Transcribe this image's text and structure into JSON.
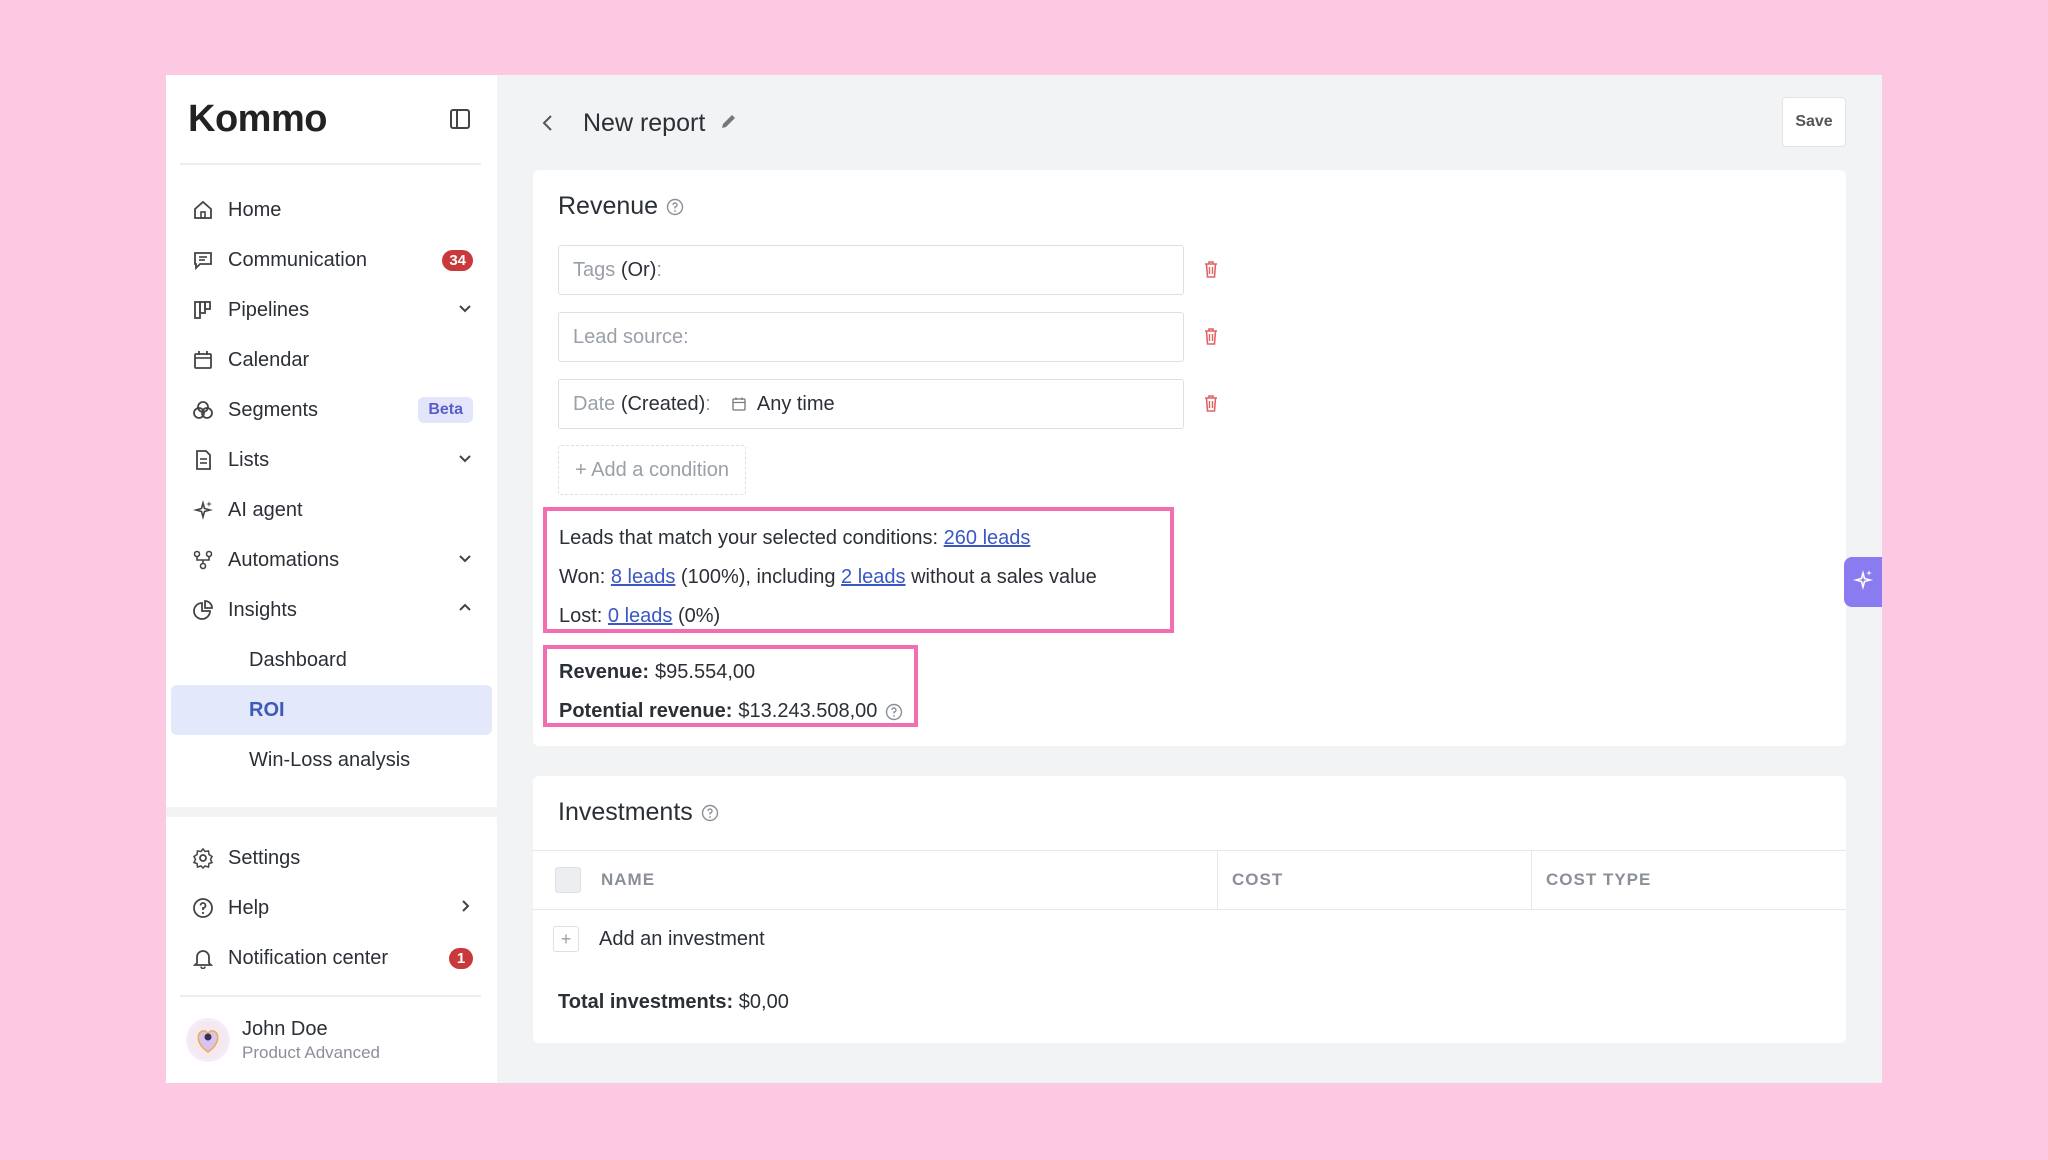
{
  "brand": {
    "logo_text": "Kommo"
  },
  "sidebar": {
    "items": [
      {
        "label": "Home",
        "icon": "home-icon"
      },
      {
        "label": "Communication",
        "icon": "chat-icon",
        "badge": "34"
      },
      {
        "label": "Pipelines",
        "icon": "pipelines-icon",
        "chevron": "down"
      },
      {
        "label": "Calendar",
        "icon": "calendar-icon"
      },
      {
        "label": "Segments",
        "icon": "segments-icon",
        "badge": "Beta"
      },
      {
        "label": "Lists",
        "icon": "lists-icon",
        "chevron": "down"
      },
      {
        "label": "AI agent",
        "icon": "sparkles-icon"
      },
      {
        "label": "Automations",
        "icon": "automations-icon",
        "chevron": "down"
      },
      {
        "label": "Insights",
        "icon": "insights-icon",
        "chevron": "up"
      }
    ],
    "insights_sub": [
      "Dashboard",
      "ROI",
      "Win-Loss analysis"
    ],
    "active_sub": "ROI",
    "bottom": [
      {
        "label": "Settings",
        "icon": "gear-icon"
      },
      {
        "label": "Help",
        "icon": "help-icon",
        "chevron": "right"
      },
      {
        "label": "Notification center",
        "icon": "bell-icon",
        "badge": "1"
      }
    ],
    "user": {
      "name": "John Doe",
      "plan": "Product Advanced"
    }
  },
  "header": {
    "title": "New report",
    "save_label": "Save"
  },
  "revenue": {
    "title": "Revenue",
    "conditions": [
      {
        "label": "Tags",
        "qualifier": "(Or)",
        "suffix": ":"
      },
      {
        "label": "Lead source:",
        "qualifier": "",
        "suffix": ""
      },
      {
        "label": "Date",
        "qualifier": "(Created)",
        "suffix": ":",
        "value": "Any time"
      }
    ],
    "add_condition": "+ Add a condition",
    "stats": {
      "match_prefix": "Leads that match your selected conditions: ",
      "match_link": "260 leads",
      "won_prefix": "Won: ",
      "won_link": "8 leads",
      "won_mid": " (100%), including ",
      "won_link2": "2 leads",
      "won_suffix": " without a sales value",
      "lost_prefix": "Lost: ",
      "lost_link": "0 leads",
      "lost_suffix": " (0%)"
    },
    "revenue_label": "Revenue:",
    "revenue_value": "$95.554,00",
    "potential_label": "Potential revenue:",
    "potential_value": "$13.243.508,00"
  },
  "investments": {
    "title": "Investments",
    "columns": [
      "NAME",
      "COST",
      "COST TYPE"
    ],
    "add_label": "Add an investment",
    "total_label": "Total investments:",
    "total_value": "$0,00"
  },
  "colors": {
    "highlight": "#f36db1",
    "link": "#3b57c4",
    "badge": "#c9393b",
    "page_bg": "#fdc8e1"
  }
}
